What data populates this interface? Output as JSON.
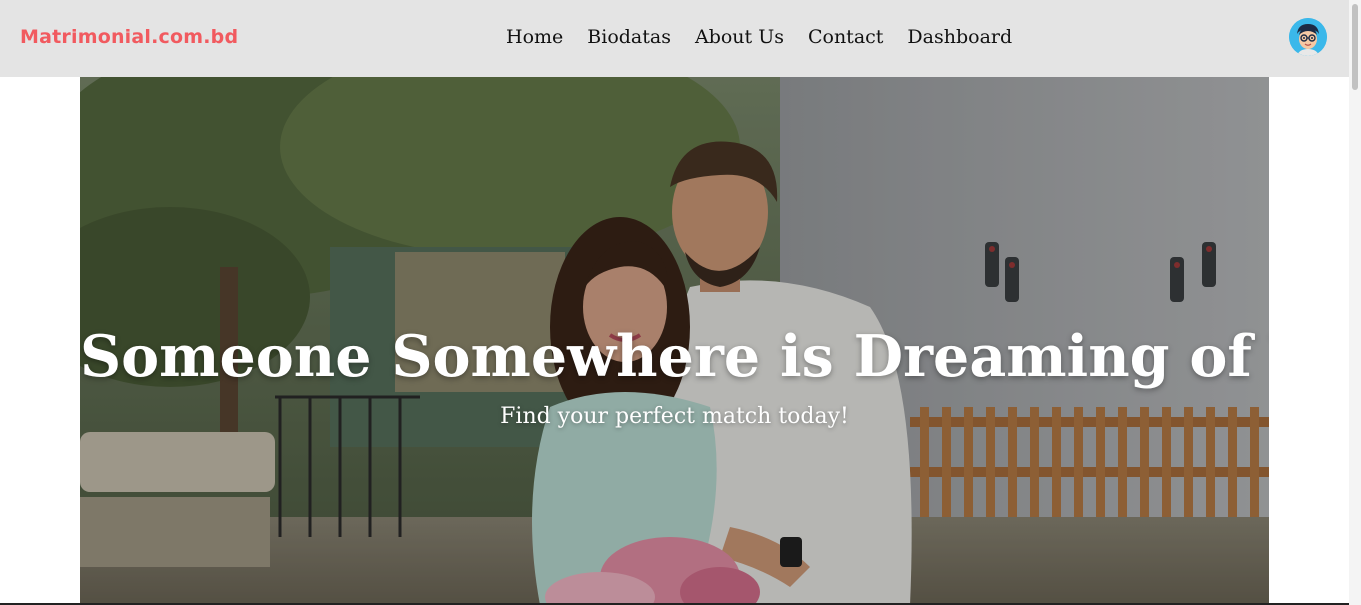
{
  "brand": {
    "name": "Matrimonial.com.bd",
    "color": "#f15a5f"
  },
  "nav": {
    "items": [
      {
        "label": "Home"
      },
      {
        "label": "Biodatas"
      },
      {
        "label": "About Us"
      },
      {
        "label": "Contact"
      },
      {
        "label": "Dashboard"
      }
    ]
  },
  "user": {
    "avatar_icon": "user-avatar-icon"
  },
  "hero": {
    "title": "Someone Somewhere is Dreaming of You",
    "subtitle": "Find your perfect match today!",
    "image": "couple-photo"
  },
  "colors": {
    "navbar_bg": "#e4e4e4",
    "text_dark": "#111111",
    "hero_text": "#ffffff"
  }
}
